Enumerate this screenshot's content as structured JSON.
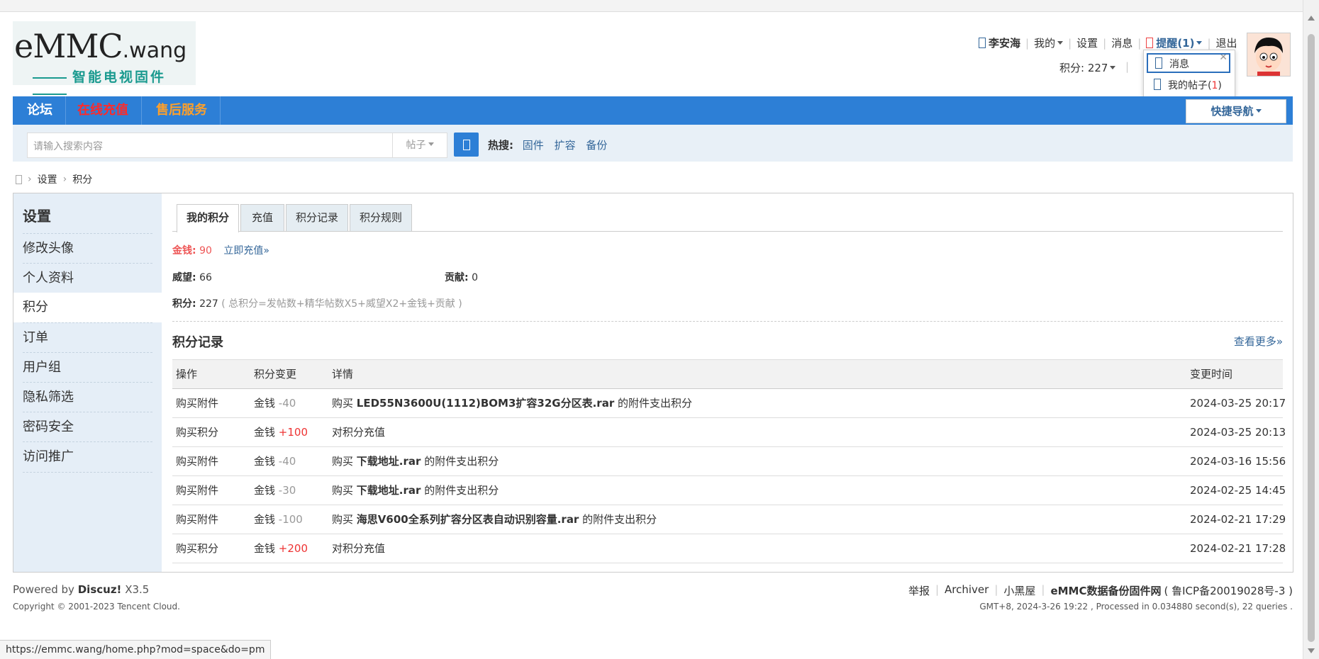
{
  "header": {
    "logo_text_main": "eMMC",
    "logo_text_small": ".wang",
    "logo_tagline": "智能电视固件",
    "user": {
      "username": "李安海",
      "mine": "我的",
      "settings": "设置",
      "messages": "消息",
      "alerts": "提醒(1)",
      "logout": "退出",
      "credits": "积分: 227"
    },
    "alert_popup": {
      "items": [
        {
          "label": "消息"
        },
        {
          "label": "我的帖子(",
          "count": "1",
          "suffix": ")"
        }
      ]
    }
  },
  "nav": {
    "items": [
      {
        "label": "论坛",
        "color": "#ffffff"
      },
      {
        "label": "在线充值",
        "color": "#ff2a2a"
      },
      {
        "label": "售后服务",
        "color": "#ffa02a"
      }
    ],
    "quick_nav": "快捷导航"
  },
  "search": {
    "placeholder": "请输入搜索内容",
    "type": "帖子",
    "hot_label": "热搜:",
    "hot_terms": [
      "固件",
      "扩容",
      "备份"
    ]
  },
  "breadcrumb": {
    "items": [
      "设置",
      "积分"
    ]
  },
  "sidebar": {
    "title": "设置",
    "items": [
      {
        "label": "修改头像"
      },
      {
        "label": "个人资料"
      },
      {
        "label": "积分",
        "active": true
      },
      {
        "label": "订单"
      },
      {
        "label": "用户组"
      },
      {
        "label": "隐私筛选"
      },
      {
        "label": "密码安全"
      },
      {
        "label": "访问推广"
      }
    ]
  },
  "tabs": [
    "我的积分",
    "充值",
    "积分记录",
    "积分规则"
  ],
  "summary": {
    "money_label": "金钱:",
    "money_value": "90",
    "recharge_link": "立即充值»",
    "prestige_label": "威望:",
    "prestige_value": "66",
    "contribution_label": "贡献:",
    "contribution_value": "0",
    "credits_label": "积分:",
    "credits_value": "227",
    "credits_formula": "( 总积分=发帖数+精华帖数X5+威望X2+金钱+贡献 )"
  },
  "records": {
    "title": "积分记录",
    "more": "查看更多»",
    "columns": [
      "操作",
      "积分变更",
      "详情",
      "变更时间"
    ],
    "rows": [
      {
        "op": "购买附件",
        "unit": "金钱",
        "change": "-40",
        "sign": "neg",
        "pre": "购买",
        "file": "LED55N3600U(1112)BOM3扩容32G分区表.rar",
        "post": "的附件支出积分",
        "time": "2024-03-25 20:17"
      },
      {
        "op": "购买积分",
        "unit": "金钱",
        "change": "+100",
        "sign": "pos",
        "pre": "对积分充值",
        "file": "",
        "post": "",
        "time": "2024-03-25 20:13"
      },
      {
        "op": "购买附件",
        "unit": "金钱",
        "change": "-40",
        "sign": "neg",
        "pre": "购买",
        "file": "下载地址.rar",
        "post": "的附件支出积分",
        "time": "2024-03-16 15:56"
      },
      {
        "op": "购买附件",
        "unit": "金钱",
        "change": "-30",
        "sign": "neg",
        "pre": "购买",
        "file": "下载地址.rar",
        "post": "的附件支出积分",
        "time": "2024-02-25 14:45"
      },
      {
        "op": "购买附件",
        "unit": "金钱",
        "change": "-100",
        "sign": "neg",
        "pre": "购买",
        "file": "海思V600全系列扩容分区表自动识别容量.rar",
        "post": "的附件支出积分",
        "time": "2024-02-21 17:29"
      },
      {
        "op": "购买积分",
        "unit": "金钱",
        "change": "+200",
        "sign": "pos",
        "pre": "对积分充值",
        "file": "",
        "post": "",
        "time": "2024-02-21 17:28"
      }
    ]
  },
  "footer": {
    "powered_prefix": "Powered by",
    "powered_name": "Discuz!",
    "powered_version": "X3.5",
    "copyright": "Copyright © 2001-2023 Tencent Cloud.",
    "links": [
      "举报",
      "Archiver",
      "小黑屋"
    ],
    "site_name": "eMMC数据备份固件网",
    "icp": "( 鲁ICP备20019028号-3 )",
    "processed": "GMT+8, 2024-3-26 19:22 , Processed in 0.034880 second(s), 22 queries ."
  },
  "status_url": "https://emmc.wang/home.php?mod=space&do=pm",
  "colors": {
    "nav_blue": "#2d7fd6",
    "sidebar_bg": "#e5eef7",
    "link": "#336699",
    "accent_red": "#e33"
  }
}
